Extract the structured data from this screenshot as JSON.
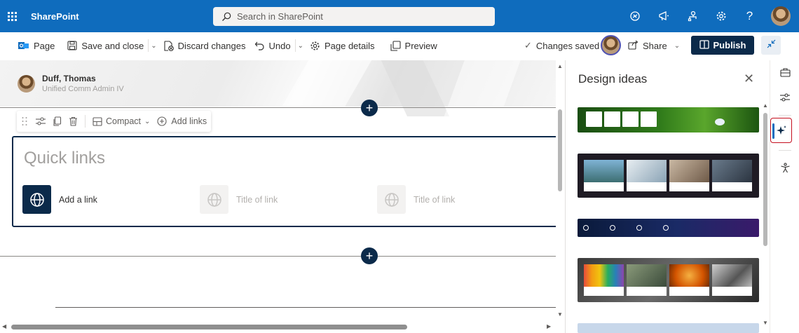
{
  "topbar": {
    "app_name": "SharePoint",
    "search_placeholder": "Search in SharePoint",
    "icons": [
      "app-launcher-icon",
      "sync-icon",
      "megaphone-icon",
      "org-icon",
      "settings-icon",
      "help-icon",
      "profile-avatar"
    ],
    "help_glyph": "?"
  },
  "commandbar": {
    "page_label": "Page",
    "save_close_label": "Save and close",
    "discard_label": "Discard changes",
    "undo_label": "Undo",
    "page_details_label": "Page details",
    "preview_label": "Preview",
    "status_label": "Changes saved",
    "share_label": "Share",
    "publish_label": "Publish"
  },
  "canvas": {
    "author": {
      "name": "Duff, Thomas",
      "role": "Unified Comm Admin IV"
    },
    "toolbar": {
      "layout_label": "Compact",
      "add_links_label": "Add links"
    },
    "quick_links": {
      "title": "Quick links",
      "links": [
        {
          "label": "Add a link",
          "state": "active"
        },
        {
          "label": "Title of link",
          "state": "placeholder"
        },
        {
          "label": "Title of link",
          "state": "placeholder"
        }
      ]
    }
  },
  "design_panel": {
    "title": "Design ideas",
    "ideas": [
      "green-nature-compact",
      "dark-photo-grid",
      "purple-banner-compact",
      "colorful-photo-grid"
    ]
  },
  "rail": {
    "icons": [
      "toolbox-icon",
      "properties-icon",
      "design-ideas-icon",
      "accessibility-icon"
    ],
    "selected": "design-ideas-icon"
  },
  "colors": {
    "brand": "#0f6cbd",
    "dark_navy": "#0b2a4a",
    "selection_border": "#c50f1f"
  }
}
